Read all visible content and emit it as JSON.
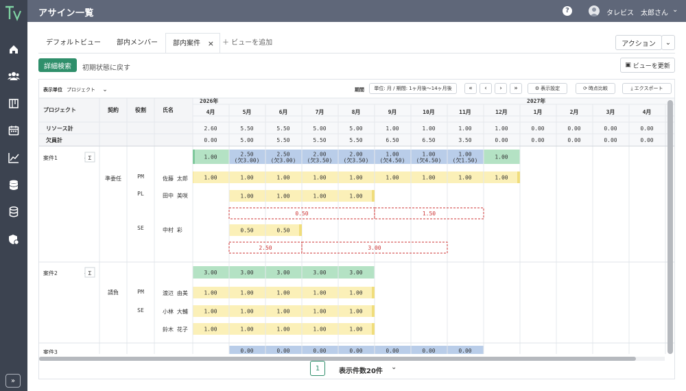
{
  "app": {
    "title": "アサイン一覧",
    "help": "?",
    "user": "タレビス　太郎さん"
  },
  "sidebar": {
    "icons": [
      "home-icon",
      "users-icon",
      "board-icon",
      "calendar-icon",
      "chart-icon",
      "database-icon",
      "storage-icon",
      "security-icon"
    ],
    "expand": "»"
  },
  "tabs": [
    "デフォルトビュー",
    "部内メンバー",
    "部内案件"
  ],
  "tab_close": "×",
  "add_view": "＋ ビューを追加",
  "action": {
    "label": "アクション",
    "chevron": "⌄"
  },
  "detail_search": "詳細検索",
  "reset": "初期状態に戻す",
  "update_view": "ビューを更新",
  "unit_label": "表示単位",
  "unit_value": "プロジェクト",
  "period_label": "期間",
  "period_value": "単位: 月 / 期間: 1ヶ月後〜14ヶ月後",
  "nav": [
    "«",
    "‹",
    "›",
    "»"
  ],
  "display_settings": "表示設定",
  "snapshot": "時点比較",
  "export": "エクスポート",
  "table": {
    "headers": {
      "project": "プロジェクト",
      "contract": "契約",
      "role": "役割",
      "name": "氏名"
    },
    "years": [
      "2026年",
      "2027年"
    ],
    "months": [
      "4月",
      "5月",
      "6月",
      "7月",
      "8月",
      "9月",
      "10月",
      "11月",
      "12月",
      "1月",
      "2月",
      "3月",
      "4月"
    ],
    "resource_label": "リソース計",
    "resource": [
      "2.60",
      "5.50",
      "5.50",
      "5.00",
      "5.00",
      "1.00",
      "1.00",
      "1.00",
      "1.00",
      "0.00",
      "0.00",
      "0.00",
      "0.00"
    ],
    "shortage_label": "欠員計",
    "shortage": [
      "0.00",
      "5.00",
      "5.50",
      "5.50",
      "5.50",
      "6.50",
      "6.50",
      "3.50",
      "0.00",
      "0.00",
      "0.00",
      "0.00",
      "0.00"
    ],
    "projects": [
      {
        "name": "案件1",
        "sigma": "Σ",
        "contract": "準委任",
        "total": [
          "1.00",
          "2.50\n(欠3.00)",
          "2.50\n(欠3.00)",
          "2.00\n(欠3.50)",
          "2.00\n(欠3.50)",
          "1.00\n(欠4.50)",
          "1.00\n(欠4.50)",
          "1.00\n(欠1.50)",
          "1.00"
        ],
        "members": [
          {
            "role": "PM",
            "name": "佐藤 太郎",
            "vals": [
              "1.00",
              "1.00",
              "1.00",
              "1.00",
              "1.00",
              "1.00",
              "1.00",
              "1.00",
              "1.00"
            ]
          },
          {
            "role": "PL",
            "name": "田中 美咲",
            "vals": [
              "1.00",
              "1.00",
              "1.00",
              "1.00"
            ],
            "vacancy": [
              "0.50",
              "1.50"
            ]
          },
          {
            "role": "SE",
            "name": "中村 彩",
            "vals": [
              "0.50",
              "0.50"
            ],
            "vacancy": [
              "2.50",
              "3.00"
            ]
          }
        ]
      },
      {
        "name": "案件2",
        "sigma": "Σ",
        "contract": "請負",
        "total": [
          "3.00",
          "3.00",
          "3.00",
          "3.00",
          "3.00"
        ],
        "members": [
          {
            "role": "PM",
            "name": "渡辺 由美",
            "vals": [
              "1.00",
              "1.00",
              "1.00",
              "1.00",
              "1.00"
            ]
          },
          {
            "role": "SE",
            "name": "小林 大輔",
            "vals": [
              "1.00",
              "1.00",
              "1.00",
              "1.00",
              "1.00"
            ]
          },
          {
            "role": "",
            "name": "鈴木 花子",
            "vals": [
              "1.00",
              "1.00",
              "1.00",
              "1.00",
              "1.00"
            ]
          }
        ]
      },
      {
        "name": "案件3",
        "sigma": "Σ",
        "total": [
          "0.00",
          "0.00",
          "0.00",
          "0.00",
          "0.00",
          "0.00",
          "0.00"
        ]
      }
    ]
  },
  "pagination": {
    "page": "1",
    "count": "表示件数20件",
    "chevron": "⌄"
  },
  "colors": {
    "topbar": "#5f6779",
    "sidebar": "#3c4350",
    "accent": "#2f8f6b",
    "green": "#b4e2c4",
    "blue": "#b9cde9",
    "yellow": "#fbf0b8",
    "vacancy": "#cc3333"
  }
}
